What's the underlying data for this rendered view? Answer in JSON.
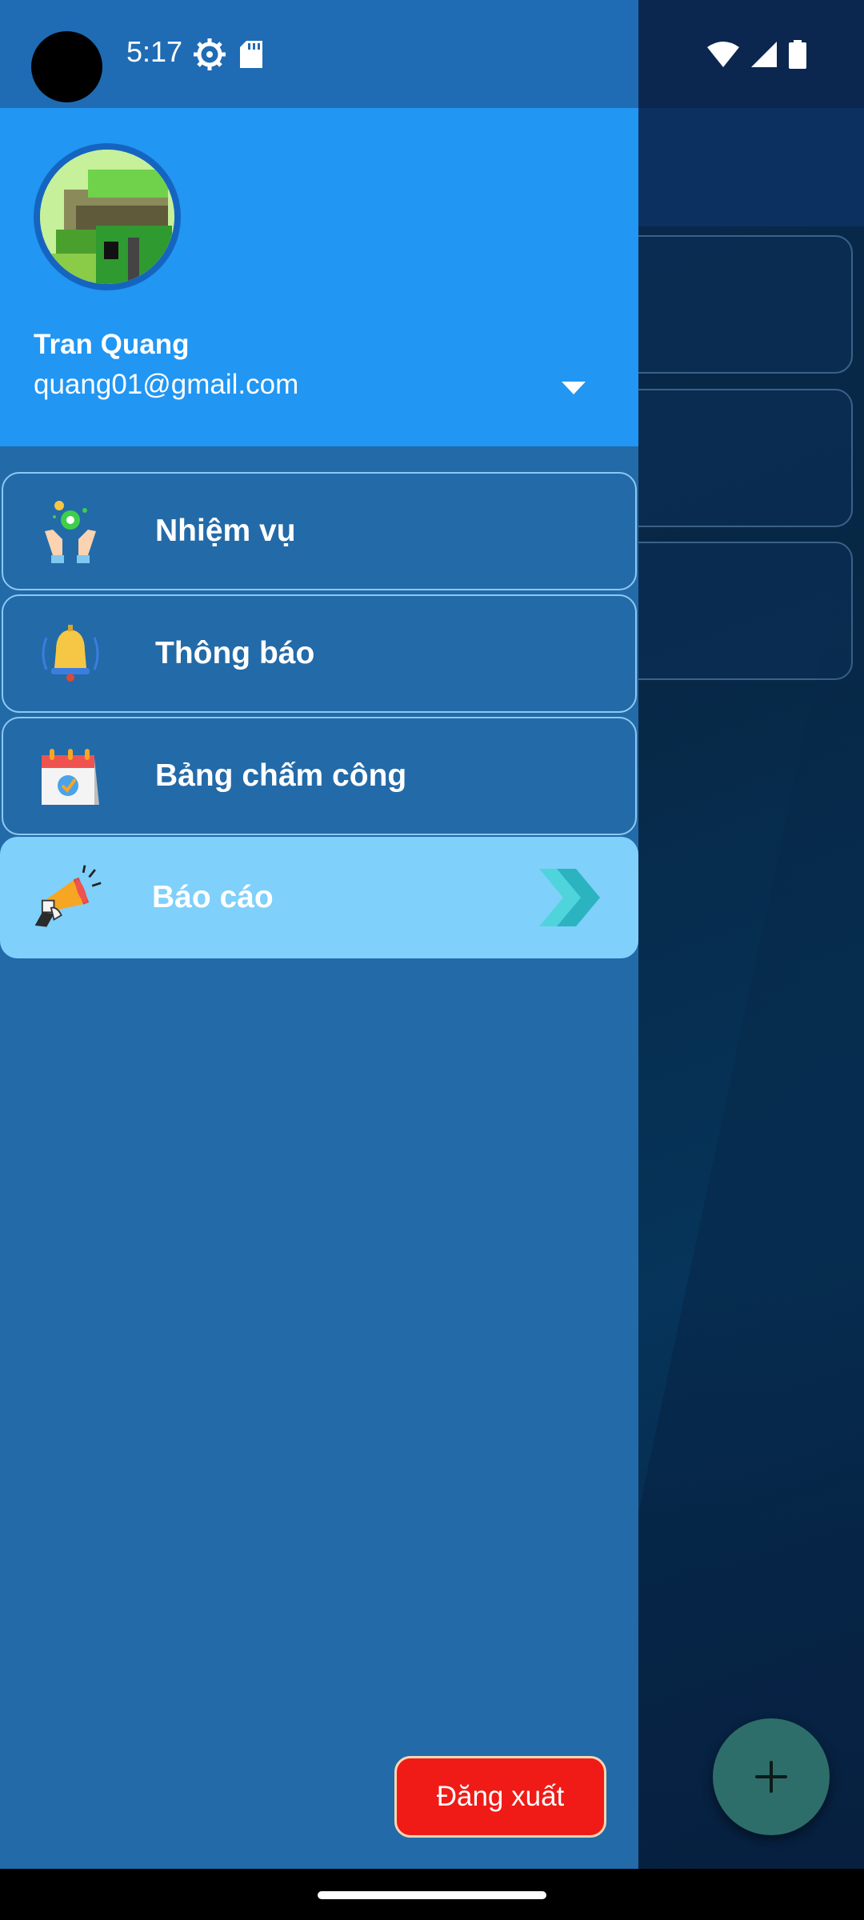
{
  "status_bar": {
    "time": "5:17",
    "left_icons": [
      "settings-gear-icon",
      "sd-card-icon"
    ],
    "right_icons": [
      "wifi-icon",
      "cellular-signal-icon",
      "battery-icon"
    ]
  },
  "drawer": {
    "user": {
      "name": "Tran Quang",
      "email": "quang01@gmail.com"
    },
    "menu_items": [
      {
        "label": "Nhiệm vụ",
        "icon": "hands-gear-icon",
        "active": false
      },
      {
        "label": "Thông báo",
        "icon": "bell-icon",
        "active": false
      },
      {
        "label": "Bảng chấm công",
        "icon": "calendar-check-icon",
        "active": false
      },
      {
        "label": "Báo cáo",
        "icon": "megaphone-icon",
        "active": true
      }
    ],
    "logout_label": "Đăng xuất"
  },
  "colors": {
    "drawer_bg": "#236aa8",
    "header_bg": "#2196f3",
    "active_item_bg": "#7fd0fb",
    "logout_bg": "#f01b16",
    "fab_bg": "#2e6e6a"
  },
  "fab": {
    "icon": "plus-icon"
  }
}
